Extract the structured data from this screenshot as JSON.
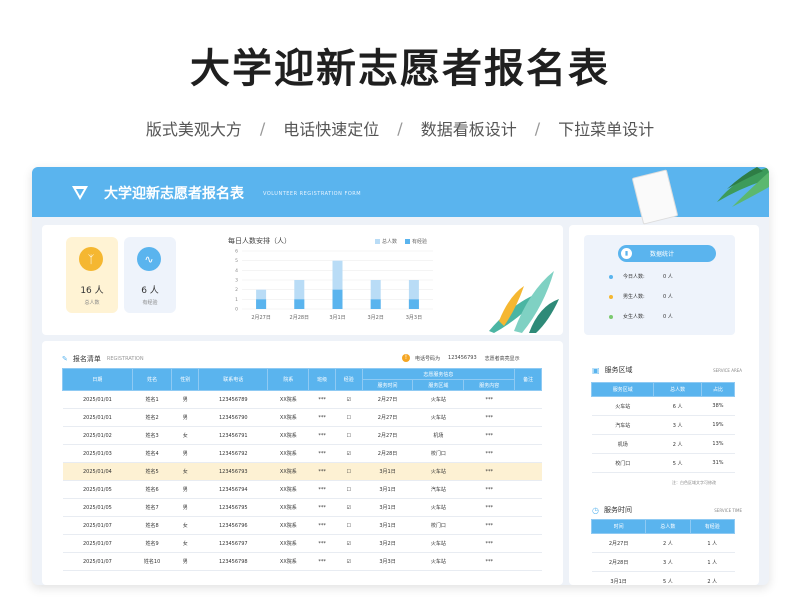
{
  "hero": {
    "title": "大学迎新志愿者报名表",
    "features": [
      "版式美观大方",
      "电话快速定位",
      "数据看板设计",
      "下拉菜单设计"
    ]
  },
  "banner": {
    "title": "大学迎新志愿者报名表",
    "subtitle_en": "VOLUNTEER REGISTRATION FORM",
    "logo_icon": "logo-icon"
  },
  "cards": [
    {
      "value": "16 人",
      "label": "总人数",
      "icon": "people-icon",
      "color": "#f5b731",
      "bg": "#fff3d4"
    },
    {
      "value": "6 人",
      "label": "有经验",
      "icon": "trend-icon",
      "color": "#5ab4ee",
      "bg": "#eef3fb"
    }
  ],
  "chart_data": {
    "type": "bar",
    "title": "每日人数安排（人）",
    "categories": [
      "2月27日",
      "2月28日",
      "3月1日",
      "3月2日",
      "3月3日"
    ],
    "series": [
      {
        "name": "总人数",
        "values": [
          2,
          3,
          5,
          3,
          3
        ],
        "color": "#b9dcf6"
      },
      {
        "name": "有经验",
        "values": [
          1,
          1,
          2,
          1,
          1
        ],
        "color": "#5ab4ee"
      }
    ],
    "ylim": [
      0,
      6
    ],
    "yticks": [
      "0",
      "1",
      "2",
      "3",
      "4",
      "5",
      "6"
    ],
    "grid": true,
    "legend": "top-right"
  },
  "registration": {
    "title": "报名清单",
    "title_en": "REGISTRATION",
    "phone_label": "电话号码为",
    "phone_value": "123456793",
    "phone_hint": "志愿者高亮显示",
    "group_header": "志愿服务信息",
    "headers": [
      "日期",
      "姓名",
      "性别",
      "联系电话",
      "院系",
      "班级",
      "经验",
      "服务时间",
      "服务区域",
      "服务内容",
      "备注"
    ],
    "rows": [
      [
        "2025/01/01",
        "姓名1",
        "男",
        "123456789",
        "XX院系",
        "***",
        "☑",
        "2月27日",
        "火车站",
        "***",
        ""
      ],
      [
        "2025/01/01",
        "姓名2",
        "男",
        "123456790",
        "XX院系",
        "***",
        "☐",
        "2月27日",
        "火车站",
        "***",
        ""
      ],
      [
        "2025/01/02",
        "姓名3",
        "女",
        "123456791",
        "XX院系",
        "***",
        "☐",
        "2月27日",
        "机场",
        "***",
        ""
      ],
      [
        "2025/01/03",
        "姓名4",
        "男",
        "123456792",
        "XX院系",
        "***",
        "☑",
        "2月28日",
        "校门口",
        "***",
        ""
      ],
      [
        "2025/01/04",
        "姓名5",
        "女",
        "123456793",
        "XX院系",
        "***",
        "☐",
        "3月1日",
        "火车站",
        "***",
        ""
      ],
      [
        "2025/01/05",
        "姓名6",
        "男",
        "123456794",
        "XX院系",
        "***",
        "☐",
        "3月1日",
        "汽车站",
        "***",
        ""
      ],
      [
        "2025/01/05",
        "姓名7",
        "男",
        "123456795",
        "XX院系",
        "***",
        "☑",
        "3月1日",
        "火车站",
        "***",
        ""
      ],
      [
        "2025/01/07",
        "姓名8",
        "女",
        "123456796",
        "XX院系",
        "***",
        "☐",
        "3月1日",
        "校门口",
        "***",
        ""
      ],
      [
        "2025/01/07",
        "姓名9",
        "女",
        "123456797",
        "XX院系",
        "***",
        "☑",
        "3月2日",
        "火车站",
        "***",
        ""
      ],
      [
        "2025/01/07",
        "姓名10",
        "男",
        "123456798",
        "XX院系",
        "***",
        "☑",
        "3月3日",
        "火车站",
        "***",
        ""
      ]
    ],
    "highlight_row": 4
  },
  "stats": {
    "title": "数据统计",
    "rows": [
      {
        "label": "今日人数:",
        "value": "0 人",
        "color": "#5ab4ee"
      },
      {
        "label": "男生人数:",
        "value": "0 人",
        "color": "#f5b731"
      },
      {
        "label": "女生人数:",
        "value": "0 人",
        "color": "#7bc96f"
      }
    ]
  },
  "service_area": {
    "title": "服务区域",
    "title_en": "SERVICE AREA",
    "headers": [
      "服务区域",
      "总人数",
      "占比"
    ],
    "rows": [
      [
        "火车站",
        "6 人",
        "38%"
      ],
      [
        "汽车站",
        "3 人",
        "19%"
      ],
      [
        "机场",
        "2 人",
        "13%"
      ],
      [
        "校门口",
        "5 人",
        "31%"
      ]
    ],
    "note": "注：白色区域文字可修改"
  },
  "service_time": {
    "title": "服务时间",
    "title_en": "SERVICE TIME",
    "headers": [
      "时间",
      "总人数",
      "有经验"
    ],
    "rows": [
      [
        "2月27日",
        "2 人",
        "1 人"
      ],
      [
        "2月28日",
        "3 人",
        "1 人"
      ],
      [
        "3月1日",
        "5 人",
        "2 人"
      ]
    ]
  }
}
